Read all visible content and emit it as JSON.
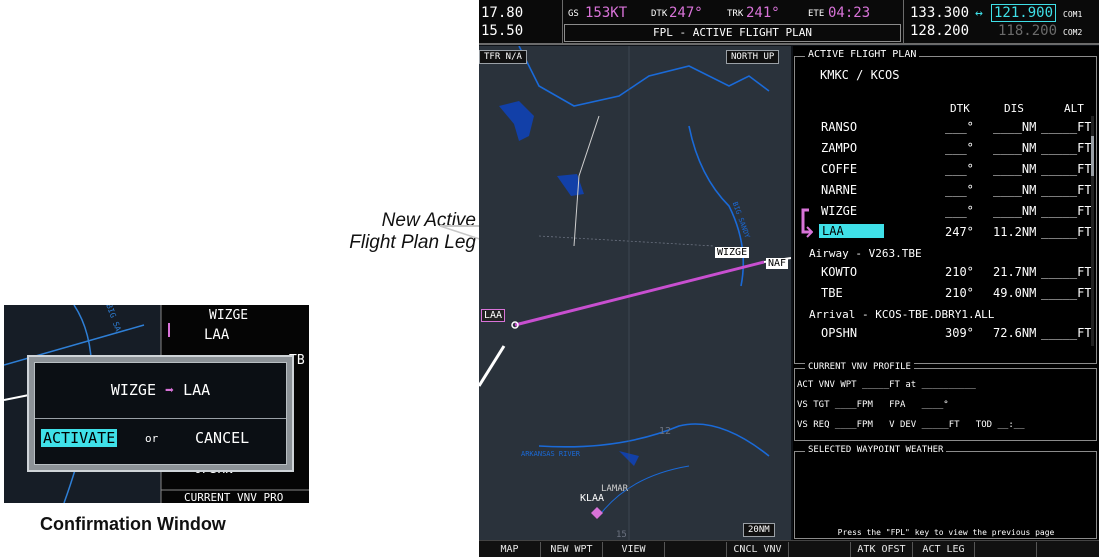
{
  "callout": {
    "line1": "New Active",
    "line2": "Flight Plan Leg"
  },
  "caption": "Confirmation Window",
  "topbar": {
    "nav1_active": "17.80",
    "nav2_active": "15.50",
    "gs_label": "GS",
    "gs_value": "153KT",
    "dtk_label": "DTK",
    "dtk_value": "247°",
    "trk_label": "TRK",
    "trk_value": "241°",
    "ete_label": "ETE",
    "ete_value": "04:23",
    "com1_active": "133.300",
    "com1_swap": "↔",
    "com1_standby": "121.900",
    "com1_label": "COM1",
    "com2_active": "128.200",
    "com2_standby": "118.200",
    "com2_label": "COM2",
    "page_title": "FPL - ACTIVE FLIGHT PLAN"
  },
  "map": {
    "tfr": "TFR N/A",
    "orientation": "NORTH UP",
    "wizge": "WIZGE",
    "nar": "NAF",
    "laa": "LAA",
    "lamar": "LAMAR",
    "klaa": "KLAA",
    "river": "ARKANSAS RIVER",
    "big_sandy": "BIG SANDY",
    "num12": "12",
    "num15": "15",
    "range": "20NM"
  },
  "fpl": {
    "header": "ACTIVE FLIGHT PLAN",
    "route": "KMKC / KCOS",
    "col_dtk": "DTK",
    "col_dis": "DIS",
    "col_alt": "ALT",
    "rows": [
      {
        "wpt": "RANSO",
        "dtk": "___°",
        "dis": "____NM",
        "alt": "_____FT"
      },
      {
        "wpt": "ZAMPO",
        "dtk": "___°",
        "dis": "____NM",
        "alt": "_____FT"
      },
      {
        "wpt": "COFFE",
        "dtk": "___°",
        "dis": "____NM",
        "alt": "_____FT"
      },
      {
        "wpt": "NARNE",
        "dtk": "___°",
        "dis": "____NM",
        "alt": "_____FT"
      },
      {
        "wpt": "WIZGE",
        "dtk": "___°",
        "dis": "____NM",
        "alt": "_____FT"
      },
      {
        "wpt": "LAA",
        "dtk": "247°",
        "dis": "11.2NM",
        "alt": "_____FT"
      }
    ],
    "airway_label": "Airway - V263.TBE",
    "airway_rows": [
      {
        "wpt": "KOWTO",
        "dtk": "210°",
        "dis": "21.7NM",
        "alt": "_____FT"
      },
      {
        "wpt": "TBE",
        "dtk": "210°",
        "dis": "49.0NM",
        "alt": "_____FT"
      }
    ],
    "arrival_label": "Arrival - KCOS-TBE.DBRY1.ALL",
    "arrival_rows": [
      {
        "wpt": "OPSHN",
        "dtk": "309°",
        "dis": "72.6NM",
        "alt": "_____FT"
      }
    ],
    "vnv_header": "CURRENT VNV PROFILE",
    "vnv_act": "ACT VNV WPT _____FT at __________",
    "vnv_vs_tgt": "VS TGT ____FPM   FPA   ____°",
    "vnv_vs_req": "VS REQ ____FPM   V DEV _____FT   TOD __:__",
    "wx_header": "SELECTED WAYPOINT WEATHER",
    "footer": "Press the \"FPL\" key to view the previous page"
  },
  "softkeys": [
    "MAP",
    "NEW WPT",
    "VIEW",
    "",
    "CNCL VNV",
    "",
    "ATK OFST",
    "ACT LEG",
    "",
    ""
  ],
  "inset": {
    "bg_wizge": "WIZGE",
    "bg_laa": "LAA",
    "bg_opshn": "OPSHN",
    "bg_vnv": "CURRENT VNV PRO",
    "bg_tb": "TB",
    "bg_big_sandy": "BIG SA",
    "dialog_from": "WIZGE",
    "dialog_arrow": "➡",
    "dialog_to": "LAA",
    "activate": "ACTIVATE",
    "or": "or",
    "cancel": "CANCEL"
  }
}
